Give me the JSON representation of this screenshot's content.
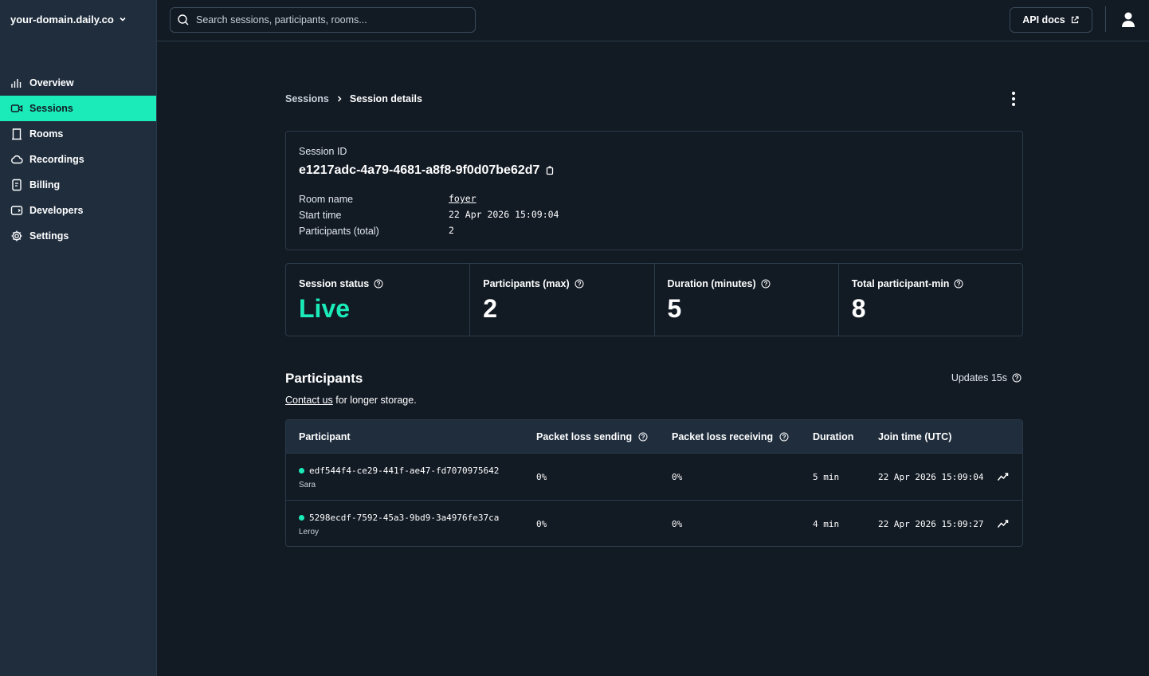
{
  "sidebar": {
    "domain": "your-domain.daily.co",
    "items": [
      {
        "label": "Overview",
        "icon": "bar-chart-icon"
      },
      {
        "label": "Sessions",
        "icon": "video-camera-icon",
        "active": true
      },
      {
        "label": "Rooms",
        "icon": "door-icon"
      },
      {
        "label": "Recordings",
        "icon": "cloud-icon"
      },
      {
        "label": "Billing",
        "icon": "receipt-icon"
      },
      {
        "label": "Developers",
        "icon": "code-window-icon"
      },
      {
        "label": "Settings",
        "icon": "gear-icon"
      }
    ]
  },
  "topbar": {
    "search_placeholder": "Search sessions, participants, rooms...",
    "api_docs_label": "API docs"
  },
  "breadcrumb": {
    "parent": "Sessions",
    "current": "Session details"
  },
  "session": {
    "id_label": "Session ID",
    "id": "e1217adc-4a79-4681-a8f8-9f0d07be62d7",
    "room_name_label": "Room name",
    "room_name": "foyer",
    "start_time_label": "Start time",
    "start_time": "22 Apr 2026 15:09:04",
    "participants_total_label": "Participants (total)",
    "participants_total": "2"
  },
  "stats": {
    "status_label": "Session status",
    "status_value": "Live",
    "participants_max_label": "Participants (max)",
    "participants_max_value": "2",
    "duration_label": "Duration (minutes)",
    "duration_value": "5",
    "total_min_label": "Total participant-min",
    "total_min_value": "8"
  },
  "participants": {
    "title": "Participants",
    "updates": "Updates 15s",
    "contact_link": "Contact us",
    "contact_text": " for longer storage.",
    "headers": {
      "participant": "Participant",
      "loss_send": "Packet loss sending",
      "loss_recv": "Packet loss receiving",
      "duration": "Duration",
      "join_time": "Join time (UTC)"
    },
    "rows": [
      {
        "id": "edf544f4-ce29-441f-ae47-fd7070975642",
        "name": "Sara",
        "loss_send": "0%",
        "loss_recv": "0%",
        "duration": "5 min",
        "join_time": "22 Apr 2026 15:09:04"
      },
      {
        "id": "5298ecdf-7592-45a3-9bd9-3a4976fe37ca",
        "name": "Leroy",
        "loss_send": "0%",
        "loss_recv": "0%",
        "duration": "4 min",
        "join_time": "22 Apr 2026 15:09:27"
      }
    ]
  },
  "colors": {
    "accent": "#1bebb9",
    "background": "#121a24",
    "sidebar": "#1f2d3d"
  }
}
